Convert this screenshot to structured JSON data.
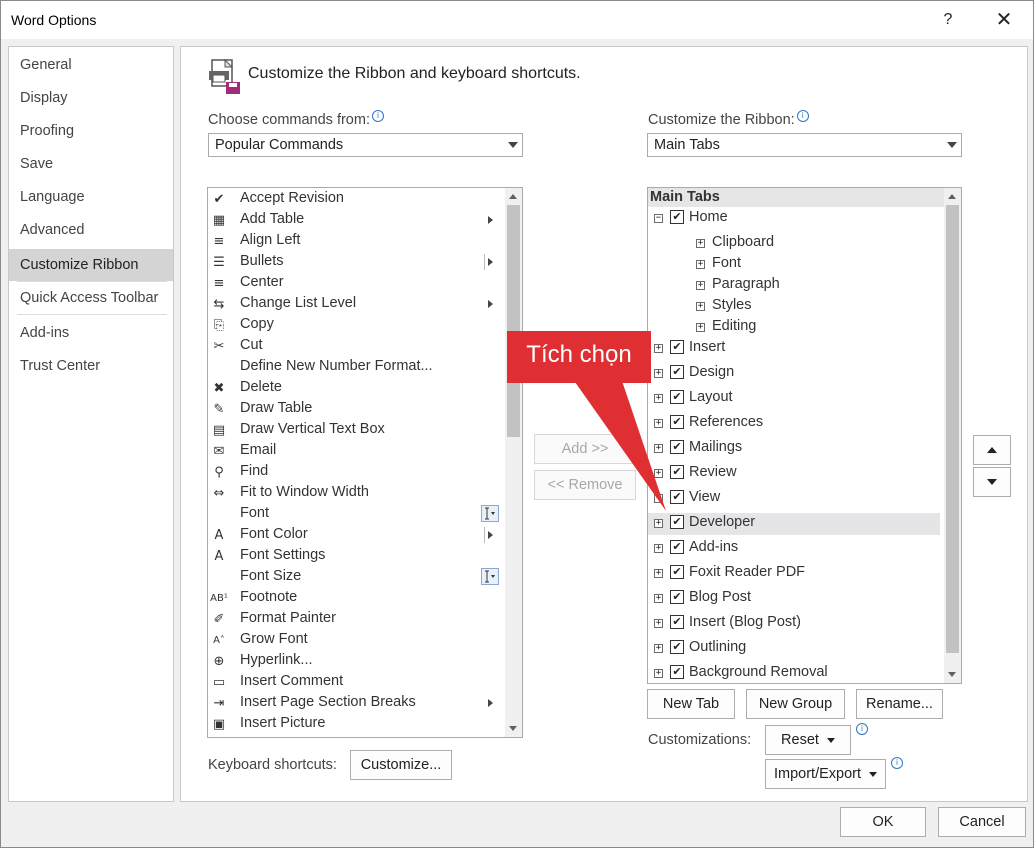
{
  "window": {
    "title": "Word Options",
    "help": "?",
    "close": "✕"
  },
  "nav": {
    "items": [
      {
        "label": "General"
      },
      {
        "label": "Display"
      },
      {
        "label": "Proofing"
      },
      {
        "label": "Save"
      },
      {
        "label": "Language"
      },
      {
        "label": "Advanced"
      },
      {
        "label": "Customize Ribbon"
      },
      {
        "label": "Quick Access Toolbar"
      },
      {
        "label": "Add-ins"
      },
      {
        "label": "Trust Center"
      }
    ],
    "selected": "Customize Ribbon"
  },
  "header": {
    "title": "Customize the Ribbon and keyboard shortcuts."
  },
  "left": {
    "label": "Choose commands from:",
    "info": "i",
    "combo_value": "Popular Commands",
    "commands": [
      {
        "label": "Accept Revision",
        "icon": "✔",
        "sub": ""
      },
      {
        "label": "Add Table",
        "icon": "▦",
        "sub": "arrow"
      },
      {
        "label": "Align Left",
        "icon": "≡",
        "sub": ""
      },
      {
        "label": "Bullets",
        "icon": "☰",
        "sub": "split"
      },
      {
        "label": "Center",
        "icon": "≡",
        "sub": ""
      },
      {
        "label": "Change List Level",
        "icon": "⇆",
        "sub": "arrow"
      },
      {
        "label": "Copy",
        "icon": "⎘",
        "sub": ""
      },
      {
        "label": "Cut",
        "icon": "✂",
        "sub": ""
      },
      {
        "label": "Define New Number Format...",
        "icon": "",
        "sub": ""
      },
      {
        "label": "Delete",
        "icon": "✖",
        "sub": ""
      },
      {
        "label": "Draw Table",
        "icon": "✎",
        "sub": ""
      },
      {
        "label": "Draw Vertical Text Box",
        "icon": "▤",
        "sub": ""
      },
      {
        "label": "Email",
        "icon": "✉",
        "sub": ""
      },
      {
        "label": "Find",
        "icon": "⚲",
        "sub": ""
      },
      {
        "label": "Fit to Window Width",
        "icon": "⇔",
        "sub": ""
      },
      {
        "label": "Font",
        "icon": "",
        "sub": "box"
      },
      {
        "label": "Font Color",
        "icon": "A",
        "sub": "split"
      },
      {
        "label": "Font Settings",
        "icon": "A",
        "sub": ""
      },
      {
        "label": "Font Size",
        "icon": "",
        "sub": "box"
      },
      {
        "label": "Footnote",
        "icon": "AB¹",
        "sub": ""
      },
      {
        "label": "Format Painter",
        "icon": "✐",
        "sub": ""
      },
      {
        "label": "Grow Font",
        "icon": "A˄",
        "sub": ""
      },
      {
        "label": "Hyperlink...",
        "icon": "⊕",
        "sub": ""
      },
      {
        "label": "Insert Comment",
        "icon": "▭",
        "sub": ""
      },
      {
        "label": "Insert Page  Section Breaks",
        "icon": "⇥",
        "sub": "arrow"
      },
      {
        "label": "Insert Picture",
        "icon": "▣",
        "sub": ""
      }
    ],
    "keyboard_label": "Keyboard shortcuts:",
    "customize_btn": "Customize..."
  },
  "middle": {
    "add_btn": "Add >>",
    "remove_btn": "<< Remove"
  },
  "right": {
    "label": "Customize the Ribbon:",
    "info": "i",
    "combo_value": "Main Tabs",
    "tree_header": "Main Tabs",
    "tree": [
      {
        "label": "Home",
        "level": 0,
        "exp": "−",
        "checked": true
      },
      {
        "label": "Clipboard",
        "level": 1,
        "exp": "+",
        "checked": null
      },
      {
        "label": "Font",
        "level": 1,
        "exp": "+",
        "checked": null
      },
      {
        "label": "Paragraph",
        "level": 1,
        "exp": "+",
        "checked": null
      },
      {
        "label": "Styles",
        "level": 1,
        "exp": "+",
        "checked": null
      },
      {
        "label": "Editing",
        "level": 1,
        "exp": "+",
        "checked": null
      },
      {
        "label": "Insert",
        "level": 0,
        "exp": "+",
        "checked": true
      },
      {
        "label": "Design",
        "level": 0,
        "exp": "+",
        "checked": true
      },
      {
        "label": "Layout",
        "level": 0,
        "exp": "+",
        "checked": true
      },
      {
        "label": "References",
        "level": 0,
        "exp": "+",
        "checked": true
      },
      {
        "label": "Mailings",
        "level": 0,
        "exp": "+",
        "checked": true
      },
      {
        "label": "Review",
        "level": 0,
        "exp": "+",
        "checked": true
      },
      {
        "label": "View",
        "level": 0,
        "exp": "+",
        "checked": true
      },
      {
        "label": "Developer",
        "level": 0,
        "exp": "+",
        "checked": true,
        "highlight": true
      },
      {
        "label": "Add-ins",
        "level": 0,
        "exp": "+",
        "checked": true
      },
      {
        "label": "Foxit Reader PDF",
        "level": 0,
        "exp": "+",
        "checked": true
      },
      {
        "label": "Blog Post",
        "level": 0,
        "exp": "+",
        "checked": true
      },
      {
        "label": "Insert (Blog Post)",
        "level": 0,
        "exp": "+",
        "checked": true
      },
      {
        "label": "Outlining",
        "level": 0,
        "exp": "+",
        "checked": true
      },
      {
        "label": "Background Removal",
        "level": 0,
        "exp": "+",
        "checked": true
      }
    ],
    "check_mark": "✔",
    "new_tab_btn": "New Tab",
    "new_group_btn": "New Group",
    "rename_btn": "Rename...",
    "customizations_label": "Customizations:",
    "reset_btn": "Reset",
    "import_export_btn": "Import/Export"
  },
  "callout": {
    "text": "Tích chọn",
    "color": "#e02f33"
  },
  "footer": {
    "ok_btn": "OK",
    "cancel_btn": "Cancel"
  }
}
